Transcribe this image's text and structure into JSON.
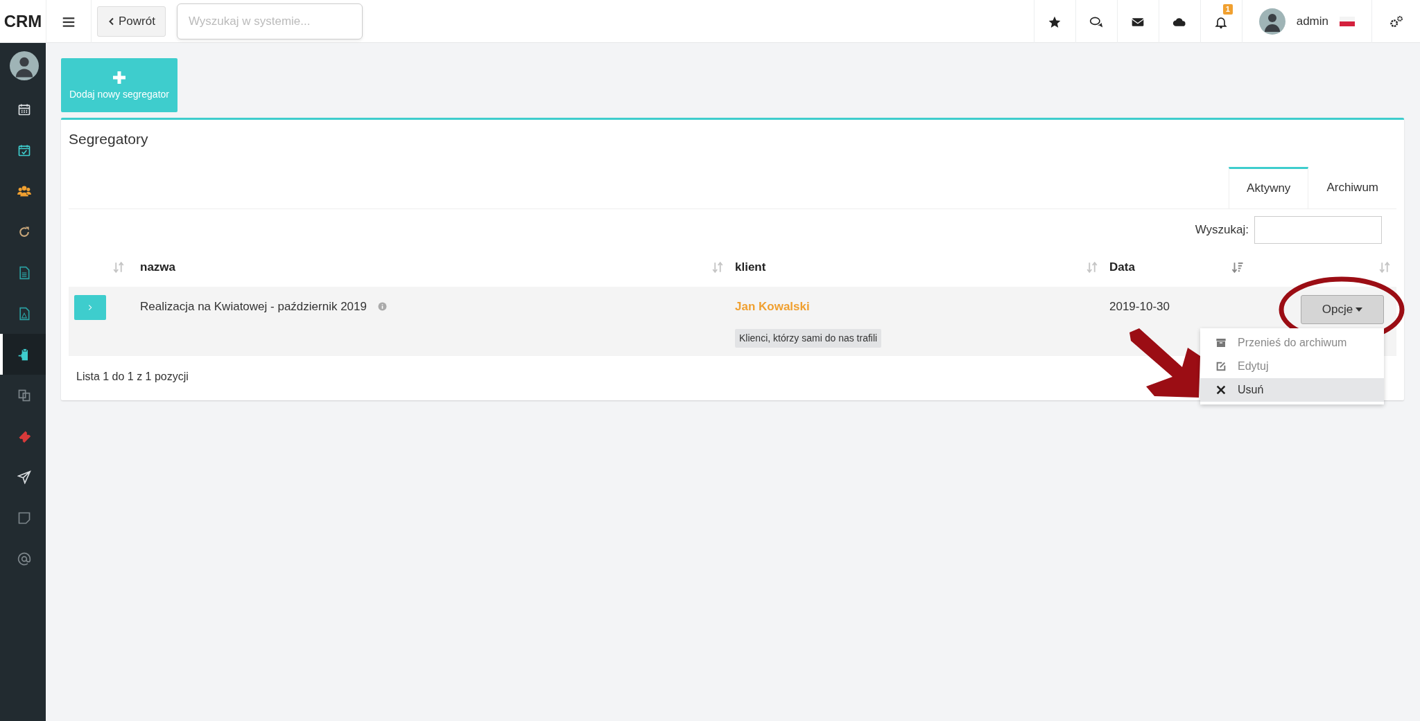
{
  "brand": "CRM",
  "topbar": {
    "back_button": "Powrót",
    "search": {
      "placeholder": "Wyszukaj w systemie..."
    },
    "notifications_badge": "1",
    "user": "admin"
  },
  "sidebar": {
    "items": [
      {
        "kind": "calendar",
        "color": "#d9dde0",
        "selected": false
      },
      {
        "kind": "calendar-check",
        "color": "#3ecdcd",
        "selected": false
      },
      {
        "kind": "users",
        "color": "#f0a030",
        "selected": false
      },
      {
        "kind": "refresh",
        "color": "#c9a77a",
        "selected": false
      },
      {
        "kind": "file",
        "color": "#2a9ea0",
        "selected": false
      },
      {
        "kind": "pdf",
        "color": "#2a9ea0",
        "selected": false
      },
      {
        "kind": "clipboard",
        "color": "#3ecdcd",
        "selected": true
      },
      {
        "kind": "copy",
        "color": "#7d868b",
        "selected": false
      },
      {
        "kind": "ticket",
        "color": "#d83a3a",
        "selected": false
      },
      {
        "kind": "plane",
        "color": "#d9dde0",
        "selected": false
      },
      {
        "kind": "note",
        "color": "#7d868b",
        "selected": false
      },
      {
        "kind": "at",
        "color": "#7d868b",
        "selected": false
      }
    ]
  },
  "add_button": "Dodaj nowy segregator",
  "panel": {
    "title": "Segregatory",
    "tabs": [
      {
        "label": "Aktywny",
        "selected": true
      },
      {
        "label": "Archiwum",
        "selected": false
      }
    ],
    "search_label": "Wyszukaj:",
    "table": {
      "columns": [
        {
          "sorted": false
        },
        {
          "label": "nazwa",
          "sorted": false
        },
        {
          "label": "klient",
          "sorted": false
        },
        {
          "label": "Data",
          "sorted": true
        },
        {
          "sorted": false
        }
      ],
      "rows": [
        {
          "name": "Realizacja na Kwiatowej - październik 2019",
          "client": "Jan Kowalski",
          "tag": "Klienci, którzy sami do nas trafili",
          "date": "2019-10-30",
          "options_button": "Opcje",
          "menu": [
            {
              "kind": "archive",
              "label": "Przenieś do archiwum",
              "highlighted": false
            },
            {
              "kind": "edit",
              "label": "Edytuj",
              "highlighted": false
            },
            {
              "kind": "delete",
              "label": "Usuń",
              "highlighted": true
            }
          ]
        }
      ]
    },
    "footer": "Lista 1 do 1 z 1 pozycji"
  }
}
